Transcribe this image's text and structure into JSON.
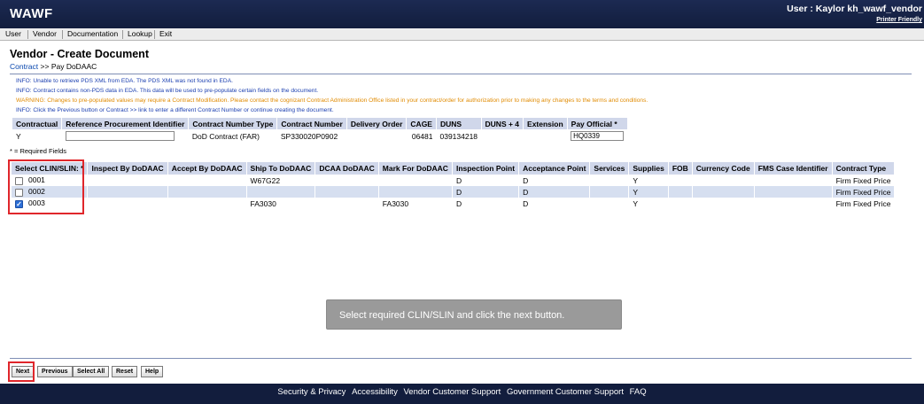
{
  "header": {
    "app_title": "WAWF",
    "user": "User : Kaylor kh_wawf_vendor",
    "printer_friendly": "Printer Friendly"
  },
  "menu": [
    "User",
    "Vendor",
    "Documentation",
    "Lookup",
    "Exit"
  ],
  "page": {
    "title": "Vendor - Create Document",
    "breadcrumb_link": "Contract",
    "breadcrumb_sep": ">>",
    "breadcrumb_current": "Pay DoDAAC"
  },
  "messages": [
    {
      "type": "info",
      "text": "INFO: Unable to retrieve PDS XML from EDA. The PDS XML was not found in EDA."
    },
    {
      "type": "info",
      "text": "INFO: Contract contains non-PDS data in EDA. This data will be used to pre-populate certain fields on the document."
    },
    {
      "type": "warn",
      "text": "WARNING: Changes to pre-populated values may require a Contract Modification. Please contact the cognizant Contract Administration Office listed in your contract/order for authorization prior to making any changes to the terms and conditions."
    },
    {
      "type": "info",
      "text": "INFO: Click the Previous button or Contract >> link to enter a different Contract Number or continue creating the document."
    }
  ],
  "contract": {
    "headers": [
      "Contractual",
      "Reference Procurement Identifier",
      "Contract Number Type",
      "Contract Number",
      "Delivery Order",
      "CAGE",
      "DUNS",
      "DUNS + 4",
      "Extension",
      "Pay Official *"
    ],
    "contractual": "Y",
    "reference_procurement_identifier": "",
    "contract_number_type": "DoD Contract (FAR)",
    "contract_number": "SP330020P0902",
    "delivery_order": "",
    "cage": "06481",
    "duns": "039134218",
    "duns4": "",
    "extension": "",
    "pay_official": "HQ0339"
  },
  "required_note": "* = Required Fields",
  "clin_table": {
    "headers": [
      "Select CLIN/SLIN: *",
      "Inspect By DoDAAC",
      "Accept By DoDAAC",
      "Ship To DoDAAC",
      "DCAA DoDAAC",
      "Mark For DoDAAC",
      "Inspection Point",
      "Acceptance Point",
      "Services",
      "Supplies",
      "FOB",
      "Currency Code",
      "FMS Case Identifier",
      "Contract Type"
    ],
    "rows": [
      {
        "checked": false,
        "clin": "0001",
        "inspect_by": "",
        "accept_by": "",
        "ship_to": "W67G22",
        "dcaa": "",
        "mark_for": "",
        "inspection_point": "D",
        "acceptance_point": "D",
        "services": "",
        "supplies": "Y",
        "fob": "",
        "currency": "",
        "fms": "",
        "contract_type": "Firm Fixed Price"
      },
      {
        "checked": false,
        "clin": "0002",
        "inspect_by": "",
        "accept_by": "",
        "ship_to": "",
        "dcaa": "",
        "mark_for": "",
        "inspection_point": "D",
        "acceptance_point": "D",
        "services": "",
        "supplies": "Y",
        "fob": "",
        "currency": "",
        "fms": "",
        "contract_type": "Firm Fixed Price"
      },
      {
        "checked": true,
        "clin": "0003",
        "inspect_by": "",
        "accept_by": "",
        "ship_to": "FA3030",
        "dcaa": "",
        "mark_for": "FA3030",
        "inspection_point": "D",
        "acceptance_point": "D",
        "services": "",
        "supplies": "Y",
        "fob": "",
        "currency": "",
        "fms": "",
        "contract_type": "Firm Fixed Price"
      }
    ]
  },
  "tooltip": "Select required CLIN/SLIN and click the next button.",
  "buttons": {
    "next": "Next",
    "previous": "Previous",
    "select_all": "Select All",
    "reset": "Reset",
    "help": "Help"
  },
  "footer": [
    "Security & Privacy",
    "Accessibility",
    "Vendor Customer Support",
    "Government Customer Support",
    "FAQ"
  ]
}
